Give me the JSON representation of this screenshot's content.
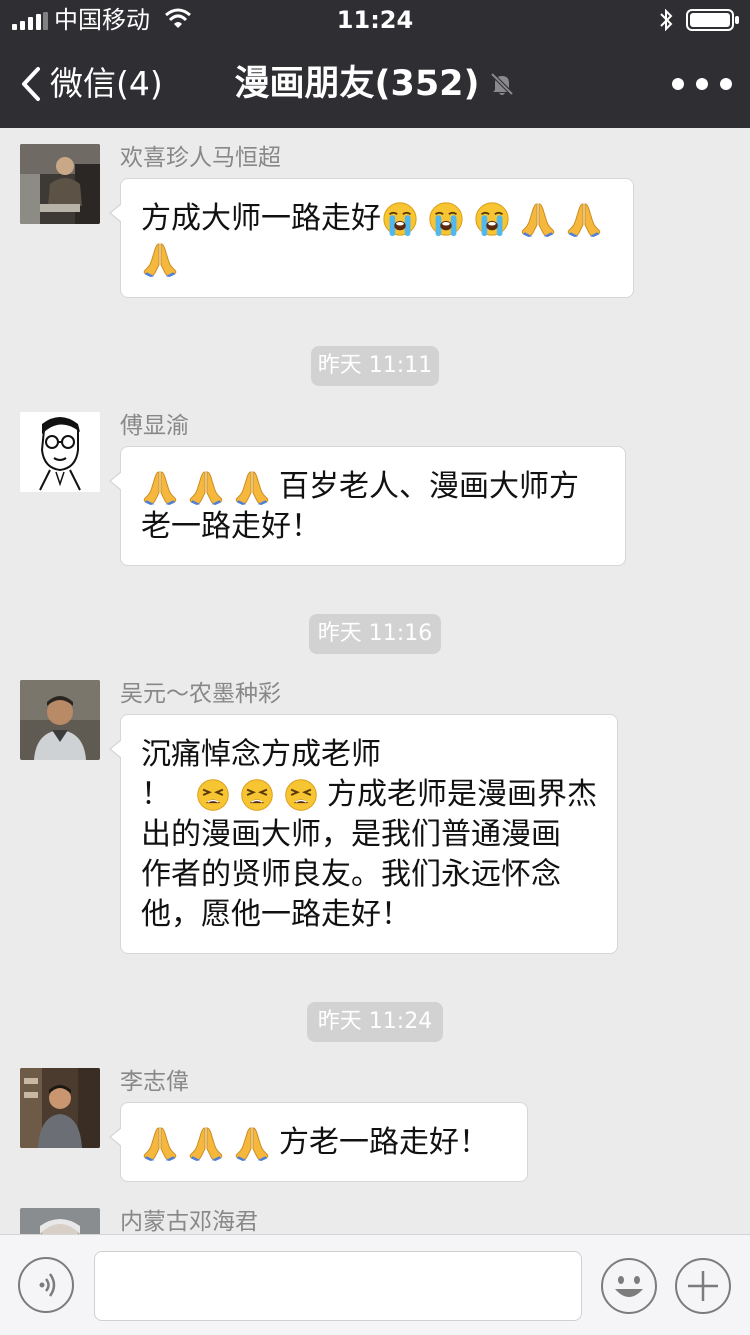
{
  "status_bar": {
    "carrier": "中国移动",
    "time": "11:24"
  },
  "nav": {
    "back_label": "微信(4)",
    "title": "漫画朋友(352)"
  },
  "messages": [
    {
      "sender": "欢喜珍人马恒超",
      "lines": [
        {
          "emoji": [
            "loudly-crying-face",
            "loudly-crying-face",
            "loudly-crying-face",
            "folded-hands",
            "folded-hands"
          ],
          "text_before": "方成大师一路走好"
        },
        {
          "emoji_only": [
            "folded-hands"
          ]
        }
      ]
    },
    {
      "timestamp": "昨天 11:11"
    },
    {
      "sender": "傅显渝",
      "lines": [
        {
          "emoji_lead": [
            "folded-hands",
            "folded-hands",
            "folded-hands"
          ],
          "text": "百岁老人、漫画大师方"
        },
        {
          "text": "老一路走好！"
        }
      ]
    },
    {
      "timestamp": "昨天 11:16"
    },
    {
      "sender": "吴元～农墨种彩",
      "lines": [
        {
          "text": "沉痛悼念方成老师"
        },
        {
          "text_before": "！",
          "emoji_mid": [
            "tired-face",
            "tired-face",
            "tired-face"
          ],
          "text": "方成老师是漫画界杰"
        },
        {
          "text": "出的漫画大师，是我们普通漫画"
        },
        {
          "text": "作者的贤师良友。我们永远怀念"
        },
        {
          "text": "他，愿他一路走好！"
        }
      ]
    },
    {
      "timestamp": "昨天 11:24"
    },
    {
      "sender": "李志偉",
      "lines": [
        {
          "emoji_lead": [
            "folded-hands",
            "folded-hands",
            "folded-hands"
          ],
          "text": "方老一路走好！"
        }
      ]
    },
    {
      "sender": "内蒙古邓海君"
    }
  ],
  "texts": {
    "m1_l1": "方成大师一路走好",
    "ts1": "昨天 11:11",
    "m2_sender": "傅显渝",
    "m2_l1": "百岁老人、漫画大师方",
    "m2_l2": "老一路走好！",
    "ts2": "昨天 11:16",
    "m3_sender": "吴元～农墨种彩",
    "m3_l1": "沉痛悼念方成老师",
    "m3_l2a": "！",
    "m3_l2b": "方成老师是漫画界杰",
    "m3_l3": "出的漫画大师，是我们普通漫画",
    "m3_l4": "作者的贤师良友。我们永远怀念",
    "m3_l5": "他，愿他一路走好！",
    "ts3": "昨天 11:24",
    "m4_sender": "李志偉",
    "m4_l1": "方老一路走好！",
    "m5_sender": "内蒙古邓海君",
    "m1_sender": "欢喜珍人马恒超"
  },
  "input": {
    "placeholder": ""
  },
  "icons": {
    "back": "chevron-left-icon",
    "mute": "bell-slash-icon",
    "more": "more-icon",
    "voice": "voice-icon",
    "emoji": "emoji-icon",
    "plus": "plus-icon"
  },
  "colors": {
    "nav_bg": "#2e2e33",
    "chat_bg": "#ebebeb",
    "bubble_bg": "#ffffff",
    "timestamp_bg": "#d2d2d2"
  }
}
